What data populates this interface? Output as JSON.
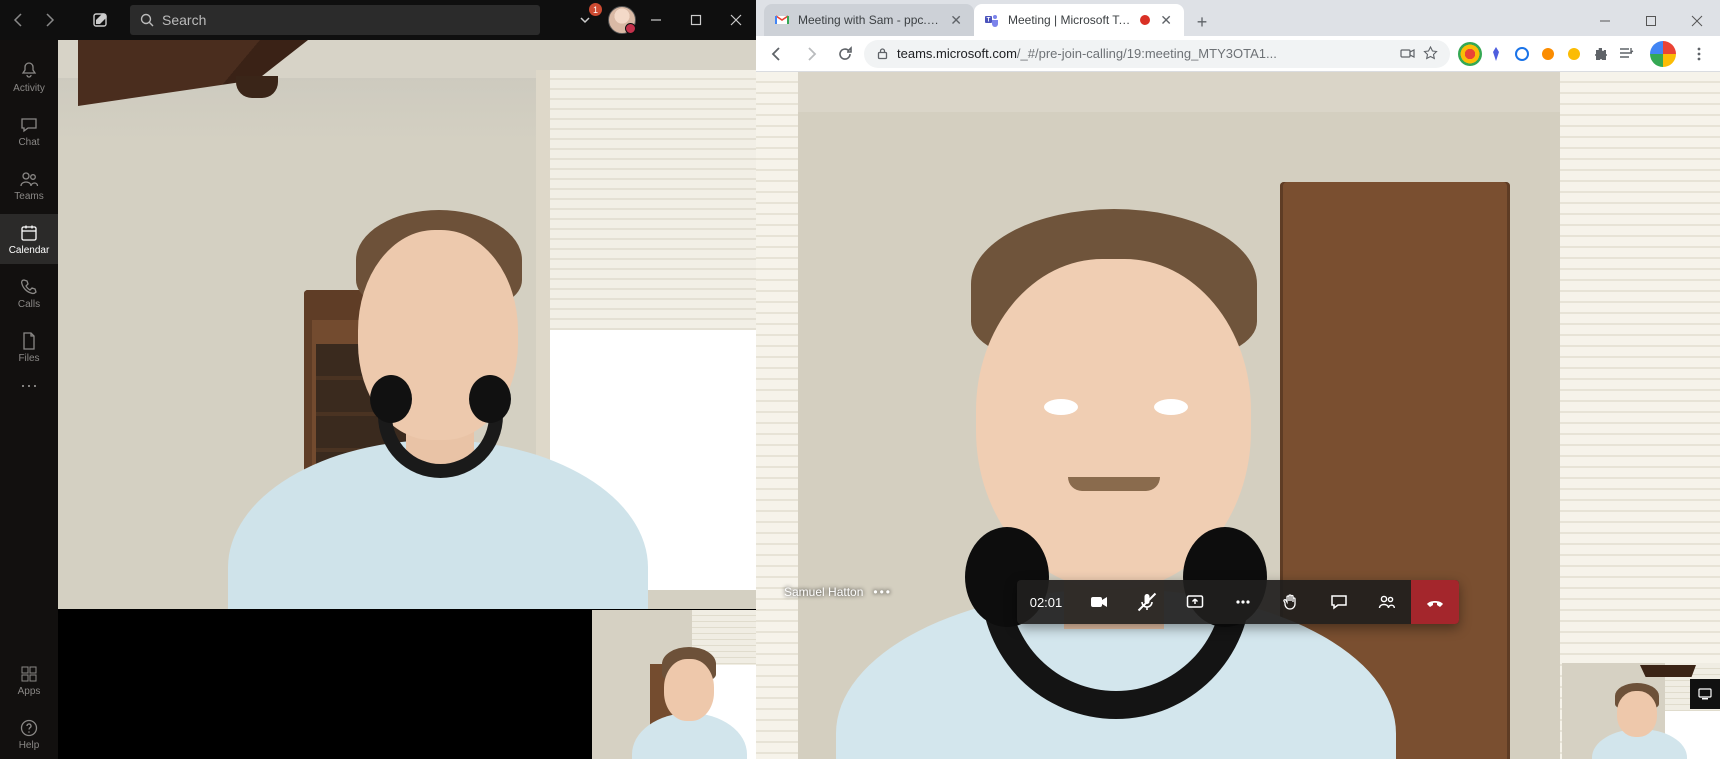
{
  "app": {
    "search_placeholder": "Search",
    "notification_badge": "1",
    "rail": [
      {
        "label": "Activity"
      },
      {
        "label": "Chat"
      },
      {
        "label": "Teams",
        "badge": ""
      },
      {
        "label": "Calendar"
      },
      {
        "label": "Calls"
      },
      {
        "label": "Files"
      }
    ],
    "rail_apps": "Apps",
    "rail_help": "Help"
  },
  "browser": {
    "tabs": [
      {
        "title": "Meeting with Sam - ppc.endsigh"
      },
      {
        "title": "Meeting | Microsoft Teams"
      }
    ],
    "url_host": "teams.microsoft.com",
    "url_path": "/_#/pre-join-calling/19:meeting_MTY3OTA1..."
  },
  "call": {
    "timer": "02:01",
    "participant": "Samuel Hatton"
  }
}
